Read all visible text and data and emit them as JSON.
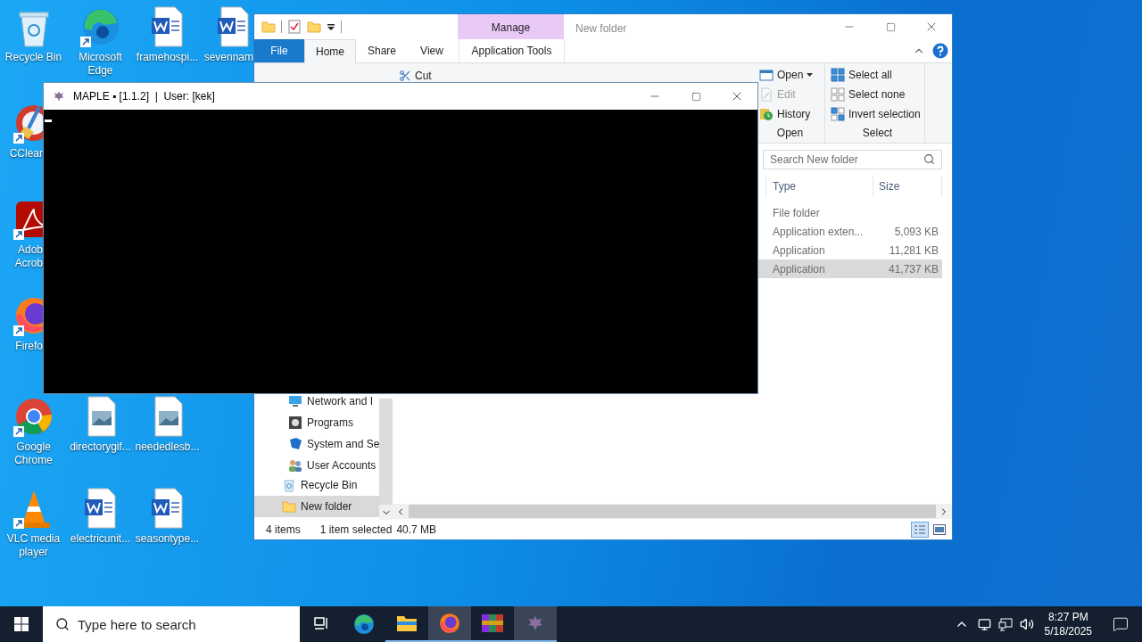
{
  "desktop_icons": [
    {
      "lines": [
        "Recycle Bin"
      ],
      "kind": "recycle",
      "shortcut": false,
      "covered": false
    },
    {
      "lines": [
        "Microsoft",
        "Edge"
      ],
      "kind": "edge",
      "shortcut": true,
      "covered": false
    },
    {
      "lines": [
        "framehospi..."
      ],
      "kind": "word",
      "shortcut": false,
      "covered": false
    },
    {
      "lines": [
        "sevennam"
      ],
      "kind": "word",
      "shortcut": false,
      "covered": true
    },
    {
      "lines": [
        "CClear"
      ],
      "kind": "ccleaner",
      "shortcut": true,
      "covered": true
    },
    {
      "lines": [
        "Adob",
        "Acrob"
      ],
      "kind": "acrobat",
      "shortcut": true,
      "covered": true
    },
    {
      "lines": [
        "Firefo"
      ],
      "kind": "firefox",
      "shortcut": true,
      "covered": true
    },
    {
      "lines": [
        "Google",
        "Chrome"
      ],
      "kind": "chrome",
      "shortcut": true,
      "covered": false
    },
    {
      "lines": [
        "directorygif..."
      ],
      "kind": "image",
      "shortcut": false,
      "covered": false
    },
    {
      "lines": [
        "neededlesb..."
      ],
      "kind": "image",
      "shortcut": false,
      "covered": false
    },
    {
      "lines": [
        "VLC media",
        "player"
      ],
      "kind": "vlc",
      "shortcut": true,
      "covered": false
    },
    {
      "lines": [
        "electricunit..."
      ],
      "kind": "word",
      "shortcut": false,
      "covered": false
    },
    {
      "lines": [
        "seasontype..."
      ],
      "kind": "word",
      "shortcut": false,
      "covered": false
    }
  ],
  "explorer": {
    "title": "New folder",
    "context_group": "Manage",
    "tabs": [
      {
        "label": "File",
        "kind": "file",
        "selected": false
      },
      {
        "label": "Home",
        "kind": "normal",
        "selected": true
      },
      {
        "label": "Share",
        "kind": "normal",
        "selected": false
      },
      {
        "label": "View",
        "kind": "normal",
        "selected": false
      },
      {
        "label": "Application Tools",
        "kind": "context",
        "selected": false
      }
    ],
    "ribbon": {
      "cut": "Cut",
      "open_group": {
        "label": "Open",
        "items": [
          {
            "label": "Open",
            "kind": "open",
            "dropdown": true,
            "disabled": false
          },
          {
            "label": "Edit",
            "kind": "edit",
            "dropdown": false,
            "disabled": true
          },
          {
            "label": "History",
            "kind": "history",
            "dropdown": false,
            "disabled": false
          }
        ]
      },
      "select_group": {
        "label": "Select",
        "items": [
          {
            "label": "Select all",
            "kind": "all"
          },
          {
            "label": "Select none",
            "kind": "none"
          },
          {
            "label": "Invert selection",
            "kind": "invert"
          }
        ]
      }
    },
    "search": {
      "placeholder": "Search New folder"
    },
    "nav": {
      "control_panel_items": [
        {
          "label": "Network and I",
          "kind": "network"
        },
        {
          "label": "Programs",
          "kind": "programs"
        },
        {
          "label": "System and Se",
          "kind": "security"
        },
        {
          "label": "User Accounts",
          "kind": "users"
        }
      ],
      "items": [
        {
          "label": "Recycle Bin",
          "kind": "recycle",
          "selected": false
        },
        {
          "label": "New folder",
          "kind": "folder",
          "selected": true
        }
      ]
    },
    "columns": [
      "Type",
      "Size"
    ],
    "rows": [
      {
        "type": "File folder",
        "selected": false
      },
      {
        "type": "Application exten...",
        "size": "5,093 KB",
        "selected": false
      },
      {
        "type": "Application",
        "size": "11,281 KB",
        "selected": false
      },
      {
        "type": "Application",
        "size": "41,737 KB",
        "selected": true
      }
    ],
    "status": {
      "count": "4 items",
      "selection": "1 item selected",
      "size": "40.7 MB"
    }
  },
  "console": {
    "title": "MAPLE ▪ [1.1.2]  |  User: [kek]"
  },
  "taskbar": {
    "search": {
      "placeholder": "Type here to search"
    },
    "apps": [
      {
        "kind": "taskview",
        "running": false,
        "highlighted": false
      },
      {
        "kind": "edge",
        "running": false,
        "highlighted": false
      },
      {
        "kind": "explorer",
        "running": true,
        "highlighted": false
      },
      {
        "kind": "firefox",
        "running": true,
        "highlighted": true
      },
      {
        "kind": "winrar",
        "running": true,
        "highlighted": false
      },
      {
        "kind": "maple",
        "running": true,
        "highlighted": true
      }
    ],
    "time": "8:27 PM",
    "date": "5/18/2025"
  }
}
